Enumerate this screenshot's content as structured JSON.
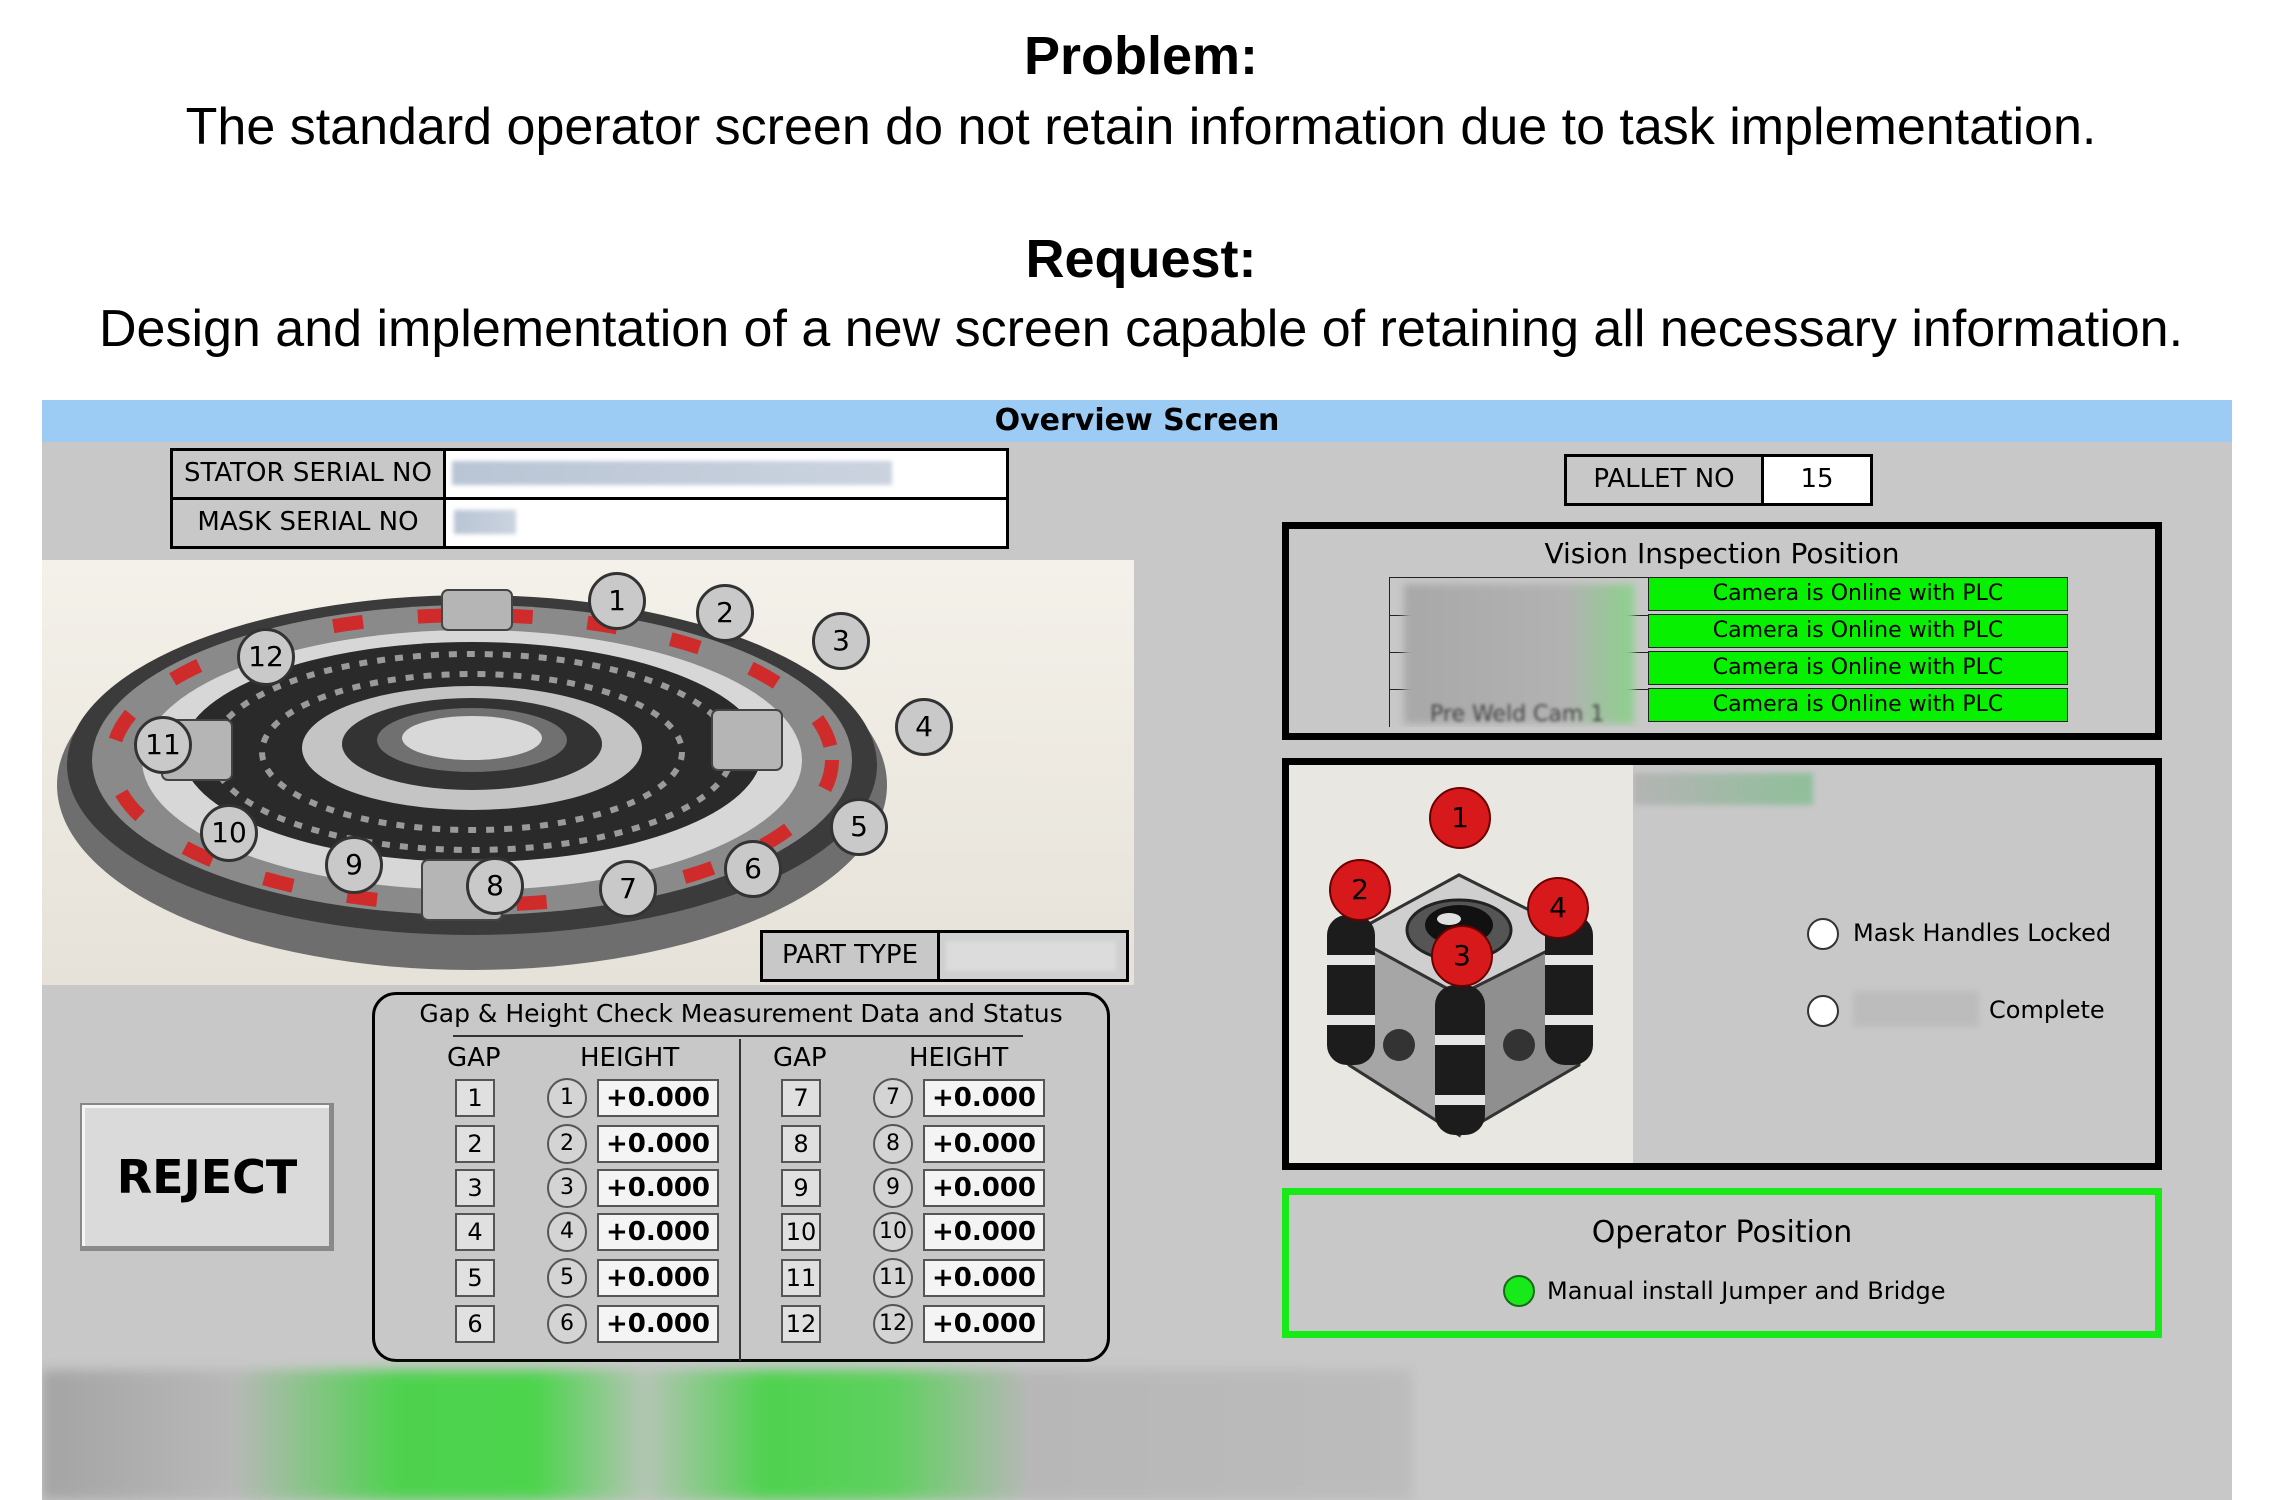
{
  "header": {
    "problem_title": "Problem:",
    "problem_text": "The standard operator screen do not retain information due to task implementation.",
    "request_title": "Request:",
    "request_text": "Design and implementation of a new screen capable of retaining all necessary information."
  },
  "screen": {
    "title": "Overview Screen",
    "stator_serial_label": "STATOR SERIAL NO",
    "mask_serial_label": "MASK SERIAL NO",
    "pallet_label": "PALLET NO",
    "pallet_value": "15",
    "part_type_label": "PART TYPE",
    "stator_numbers": [
      "1",
      "2",
      "3",
      "4",
      "5",
      "6",
      "7",
      "8",
      "9",
      "10",
      "11",
      "12"
    ],
    "reject_label": "REJECT",
    "gap_table": {
      "title": "Gap & Height Check Measurement Data and Status",
      "gap_header": "GAP",
      "height_header": "HEIGHT",
      "left_rows": [
        {
          "gap": "1",
          "height_no": "1",
          "value": "+0.000"
        },
        {
          "gap": "2",
          "height_no": "2",
          "value": "+0.000"
        },
        {
          "gap": "3",
          "height_no": "3",
          "value": "+0.000"
        },
        {
          "gap": "4",
          "height_no": "4",
          "value": "+0.000"
        },
        {
          "gap": "5",
          "height_no": "5",
          "value": "+0.000"
        },
        {
          "gap": "6",
          "height_no": "6",
          "value": "+0.000"
        }
      ],
      "right_rows": [
        {
          "gap": "7",
          "height_no": "7",
          "value": "+0.000"
        },
        {
          "gap": "8",
          "height_no": "8",
          "value": "+0.000"
        },
        {
          "gap": "9",
          "height_no": "9",
          "value": "+0.000"
        },
        {
          "gap": "10",
          "height_no": "10",
          "value": "+0.000"
        },
        {
          "gap": "11",
          "height_no": "11",
          "value": "+0.000"
        },
        {
          "gap": "12",
          "height_no": "12",
          "value": "+0.000"
        }
      ]
    },
    "vision": {
      "title": "Vision Inspection Position",
      "camera_row_partial": "Pre Weld Cam 1",
      "camera_status": [
        "Camera is Online with PLC",
        "Camera is Online with PLC",
        "Camera is Online with PLC",
        "Camera is Online with PLC"
      ],
      "status_color": "#07f000"
    },
    "mask": {
      "numbers": [
        "1",
        "2",
        "3",
        "4"
      ],
      "handles_locked": "Mask Handles Locked",
      "complete": "Complete"
    },
    "operator": {
      "title": "Operator Position",
      "task": "Manual install Jumper and Bridge",
      "indicator_color": "#18e918"
    }
  }
}
